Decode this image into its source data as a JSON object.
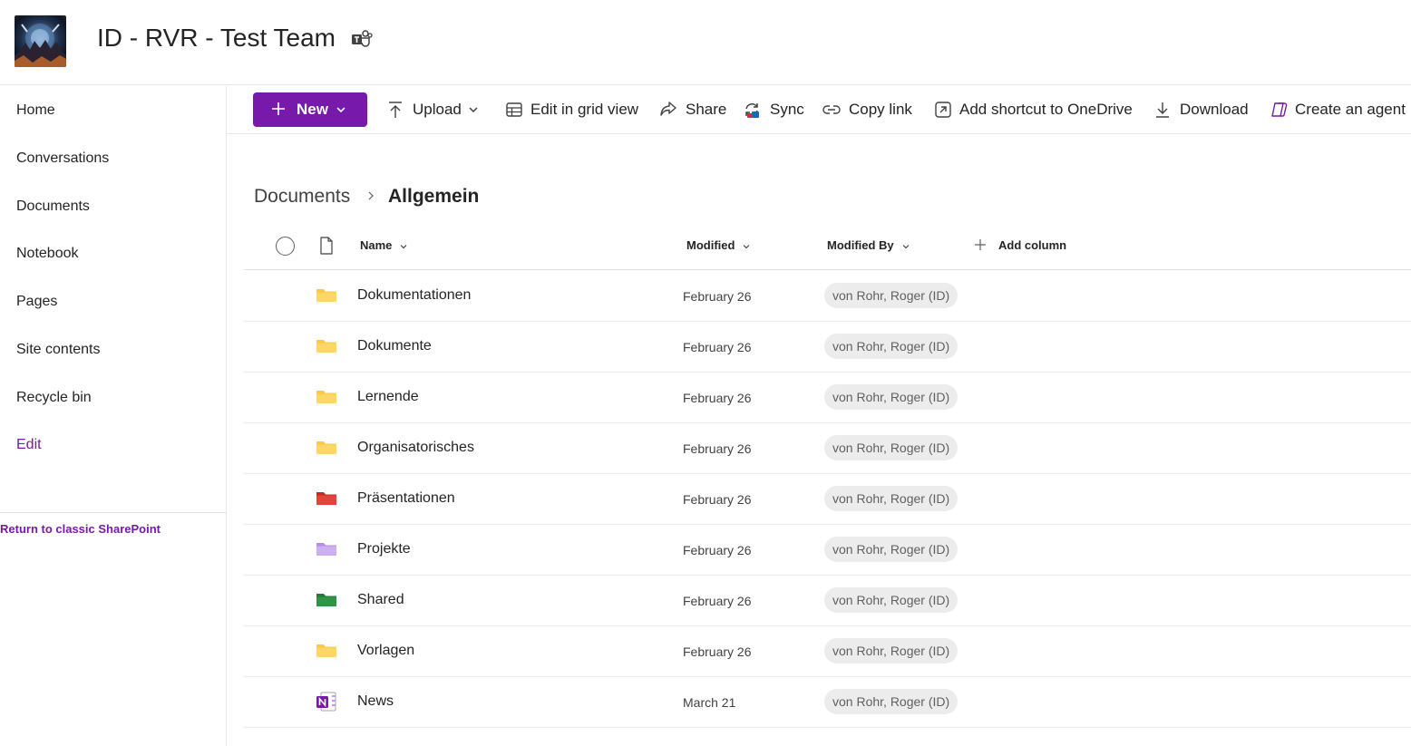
{
  "site": {
    "title": "ID - RVR - Test Team"
  },
  "nav": {
    "items": [
      {
        "label": "Home"
      },
      {
        "label": "Conversations"
      },
      {
        "label": "Documents"
      },
      {
        "label": "Notebook"
      },
      {
        "label": "Pages"
      },
      {
        "label": "Site contents"
      },
      {
        "label": "Recycle bin"
      }
    ],
    "edit_label": "Edit",
    "classic_link": "Return to classic SharePoint"
  },
  "toolbar": {
    "new_label": "New",
    "upload_label": "Upload",
    "grid_label": "Edit in grid view",
    "share_label": "Share",
    "sync_label": "Sync",
    "copy_link_label": "Copy link",
    "shortcut_label": "Add shortcut to OneDrive",
    "download_label": "Download",
    "agent_label": "Create an agent"
  },
  "breadcrumb": {
    "parent": "Documents",
    "current": "Allgemein"
  },
  "list": {
    "columns": {
      "name": "Name",
      "modified": "Modified",
      "modified_by": "Modified By",
      "add_column": "Add column"
    },
    "rows": [
      {
        "name": "Dokumentationen",
        "modified": "February 26",
        "modified_by": "von Rohr, Roger (ID)",
        "icon": "folder-icon",
        "color": "#ffc83d"
      },
      {
        "name": "Dokumente",
        "modified": "February 26",
        "modified_by": "von Rohr, Roger (ID)",
        "icon": "folder-icon",
        "color": "#ffc83d"
      },
      {
        "name": "Lernende",
        "modified": "February 26",
        "modified_by": "von Rohr, Roger (ID)",
        "icon": "folder-icon",
        "color": "#ffc83d"
      },
      {
        "name": "Organisatorisches",
        "modified": "February 26",
        "modified_by": "von Rohr, Roger (ID)",
        "icon": "folder-icon",
        "color": "#ffc83d"
      },
      {
        "name": "Präsentationen",
        "modified": "February 26",
        "modified_by": "von Rohr, Roger (ID)",
        "icon": "folder-icon",
        "color": "#d13438"
      },
      {
        "name": "Projekte",
        "modified": "February 26",
        "modified_by": "von Rohr, Roger (ID)",
        "icon": "folder-icon",
        "color": "#c19bf0"
      },
      {
        "name": "Shared",
        "modified": "February 26",
        "modified_by": "von Rohr, Roger (ID)",
        "icon": "folder-icon",
        "color": "#2e8b3e"
      },
      {
        "name": "Vorlagen",
        "modified": "February 26",
        "modified_by": "von Rohr, Roger (ID)",
        "icon": "folder-icon",
        "color": "#ffc83d"
      },
      {
        "name": "News",
        "modified": "March 21",
        "modified_by": "von Rohr, Roger (ID)",
        "icon": "onenote-icon",
        "color": "#7719aa"
      }
    ]
  },
  "theme": {
    "accent": "#7719aa"
  }
}
